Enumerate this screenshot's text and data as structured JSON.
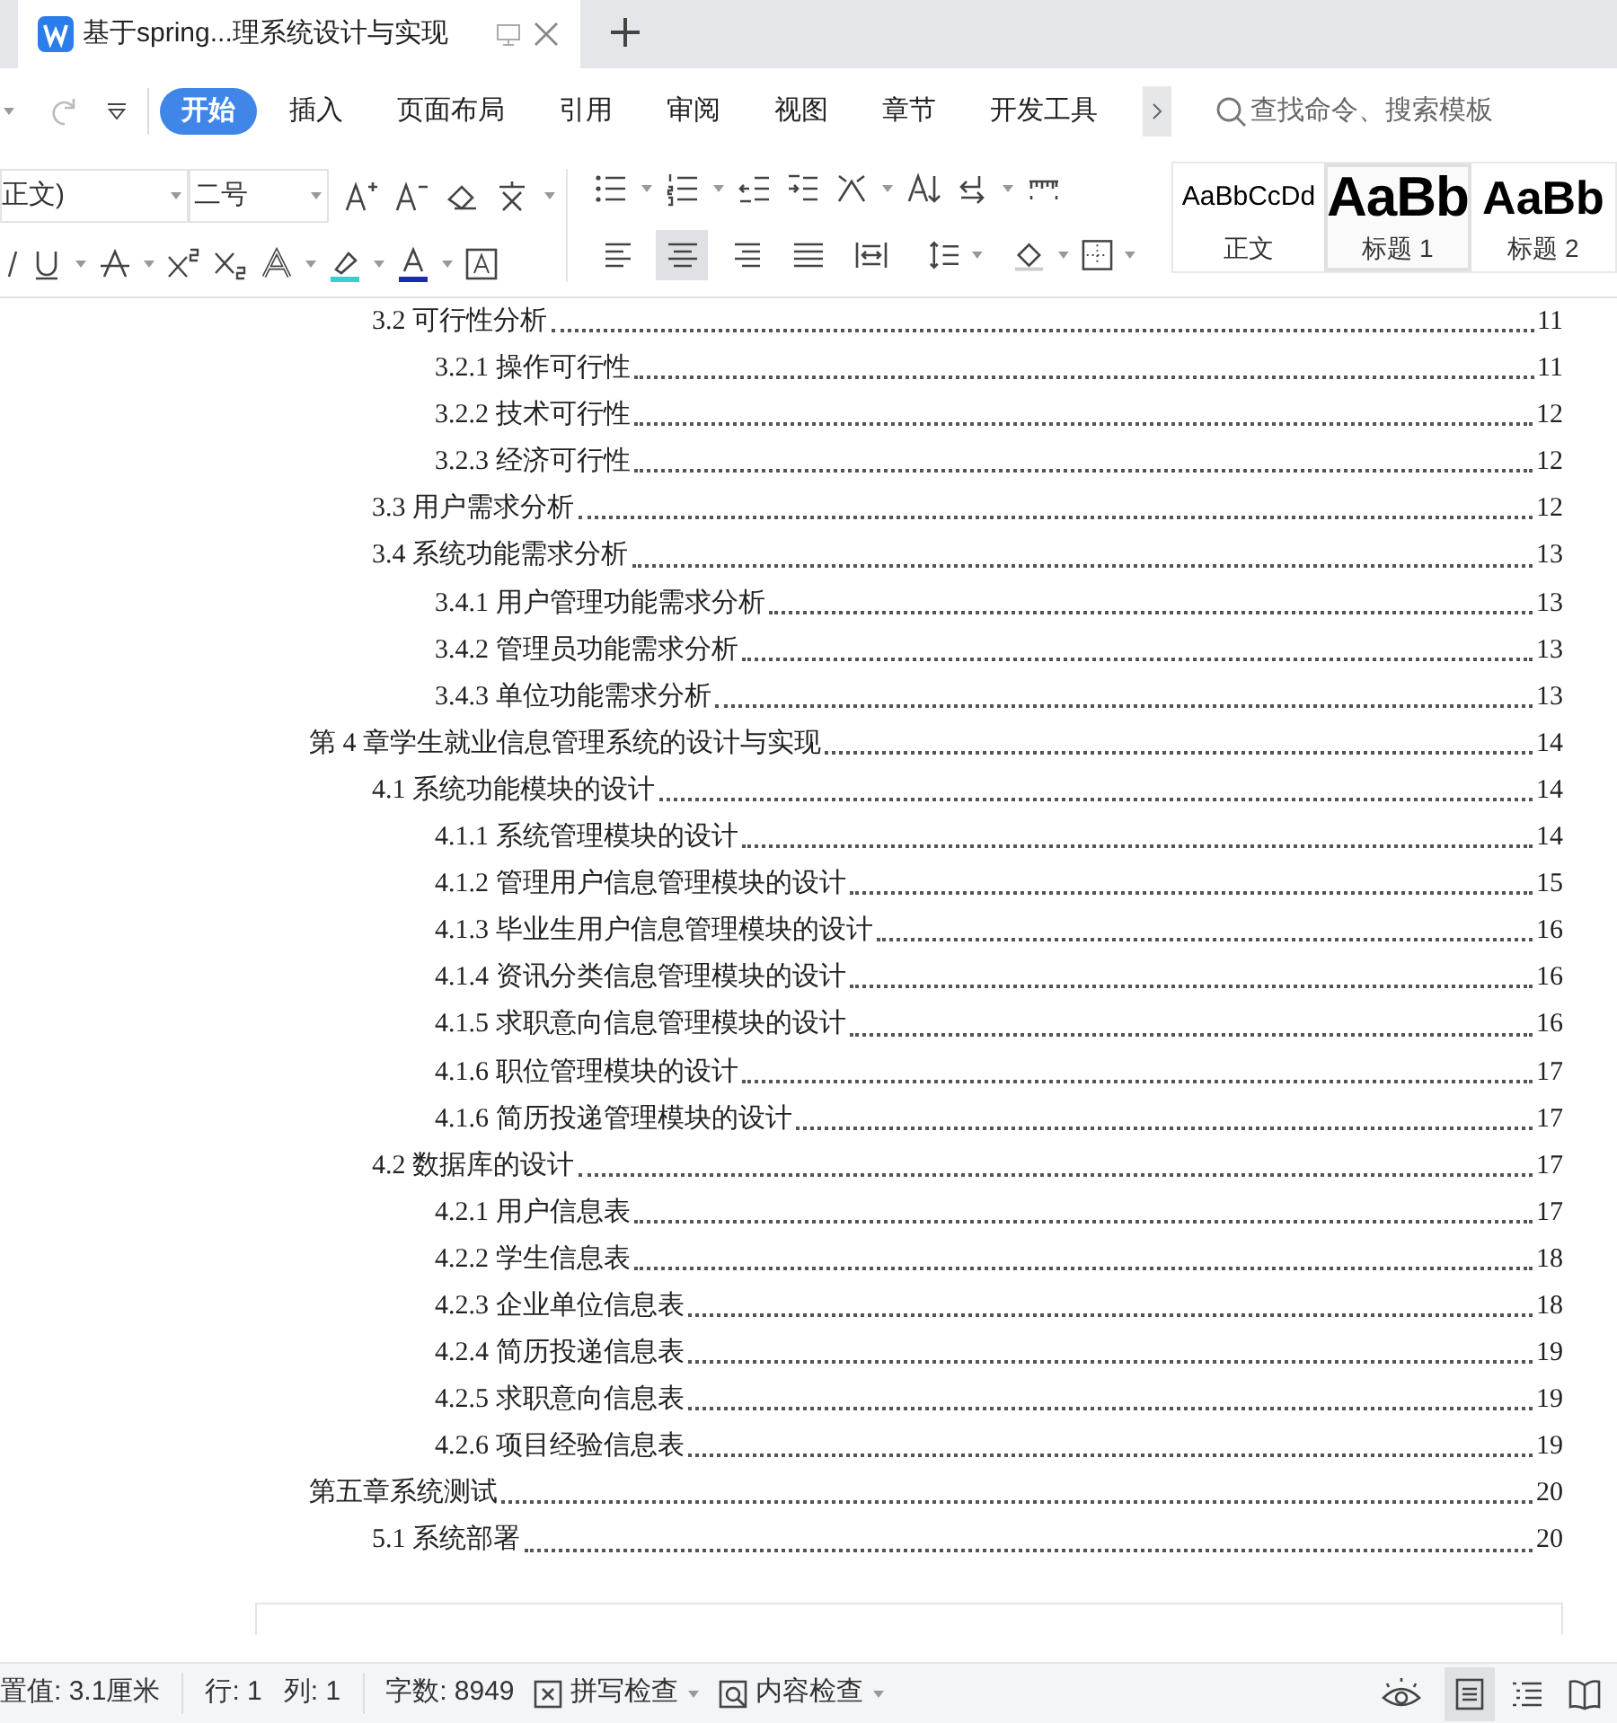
{
  "tab": {
    "title": "基于spring...理系统设计与实现"
  },
  "menu": [
    {
      "label": "开始",
      "selected": true
    },
    {
      "label": "插入",
      "selected": false
    },
    {
      "label": "页面布局",
      "selected": false
    },
    {
      "label": "引用",
      "selected": false
    },
    {
      "label": "审阅",
      "selected": false
    },
    {
      "label": "视图",
      "selected": false
    },
    {
      "label": "章节",
      "selected": false
    },
    {
      "label": "开发工具",
      "selected": false
    }
  ],
  "search": {
    "placeholder": "查找命令、搜索模板"
  },
  "font": {
    "name": "正文)",
    "size": "二号"
  },
  "align_buttons": [
    {
      "selected": false
    },
    {
      "selected": true
    },
    {
      "selected": false
    },
    {
      "selected": false
    },
    {
      "selected": false
    }
  ],
  "styles": [
    {
      "kind": "body",
      "preview": "AaBbCcDd",
      "label": "正文",
      "selected": false
    },
    {
      "kind": "heading1",
      "preview": "AaBb",
      "label": "标题 1",
      "selected": true
    },
    {
      "kind": "heading2",
      "preview": "AaBb",
      "label": "标题 2",
      "selected": false
    }
  ],
  "toc": [
    {
      "children": [
        {
          "label": "3.2 可行性分析",
          "page": "11",
          "children": [
            {
              "label": "3.2.1 操作可行性",
              "page": "11"
            },
            {
              "label": "3.2.2 技术可行性",
              "page": "12"
            },
            {
              "label": "3.2.3 经济可行性",
              "page": "12"
            }
          ]
        },
        {
          "label": "3.3 用户需求分析",
          "page": "12"
        },
        {
          "label": "3.4 系统功能需求分析",
          "page": "13",
          "children": [
            {
              "label": "3.4.1 用户管理功能需求分析",
              "page": "13"
            },
            {
              "label": "3.4.2 管理员功能需求分析",
              "page": "13"
            },
            {
              "label": "3.4.3 单位功能需求分析",
              "page": "13"
            }
          ]
        }
      ]
    },
    {
      "label": "第 4 章学生就业信息管理系统的设计与实现",
      "page": "14",
      "children": [
        {
          "label": "4.1 系统功能模块的设计",
          "page": "14",
          "children": [
            {
              "label": "4.1.1 系统管理模块的设计",
              "page": "14"
            },
            {
              "label": "4.1.2 管理用户信息管理模块的设计",
              "page": "15"
            },
            {
              "label": "4.1.3 毕业生用户信息管理模块的设计",
              "page": "16"
            },
            {
              "label": "4.1.4 资讯分类信息管理模块的设计",
              "page": "16"
            },
            {
              "label": "4.1.5 求职意向信息管理模块的设计",
              "page": "16"
            },
            {
              "label": "4.1.6 职位管理模块的设计",
              "page": "17"
            },
            {
              "label": "4.1.6 简历投递管理模块的设计",
              "page": "17"
            }
          ]
        },
        {
          "label": "4.2 数据库的设计",
          "page": "17",
          "children": [
            {
              "label": "4.2.1 用户信息表",
              "page": "17"
            },
            {
              "label": "4.2.2 学生信息表",
              "page": "18"
            },
            {
              "label": "4.2.3 企业单位信息表",
              "page": "18"
            },
            {
              "label": "4.2.4 简历投递信息表",
              "page": "19"
            },
            {
              "label": "4.2.5 求职意向信息表",
              "page": "19"
            },
            {
              "label": "4.2.6 项目经验信息表",
              "page": "19"
            }
          ]
        }
      ]
    },
    {
      "label": "第五章系统测试",
      "page": "20",
      "children": [
        {
          "label": "5.1 系统部署",
          "page": "20"
        }
      ]
    }
  ],
  "status_bar": {
    "items": [
      "置值: 3.1厘米",
      "行: 1",
      "列: 1",
      "字数: 8949"
    ],
    "checks": [
      "拼写检查",
      "内容检查"
    ],
    "views": [
      {
        "selected": true
      },
      {
        "selected": false
      },
      {
        "selected": false
      }
    ]
  }
}
